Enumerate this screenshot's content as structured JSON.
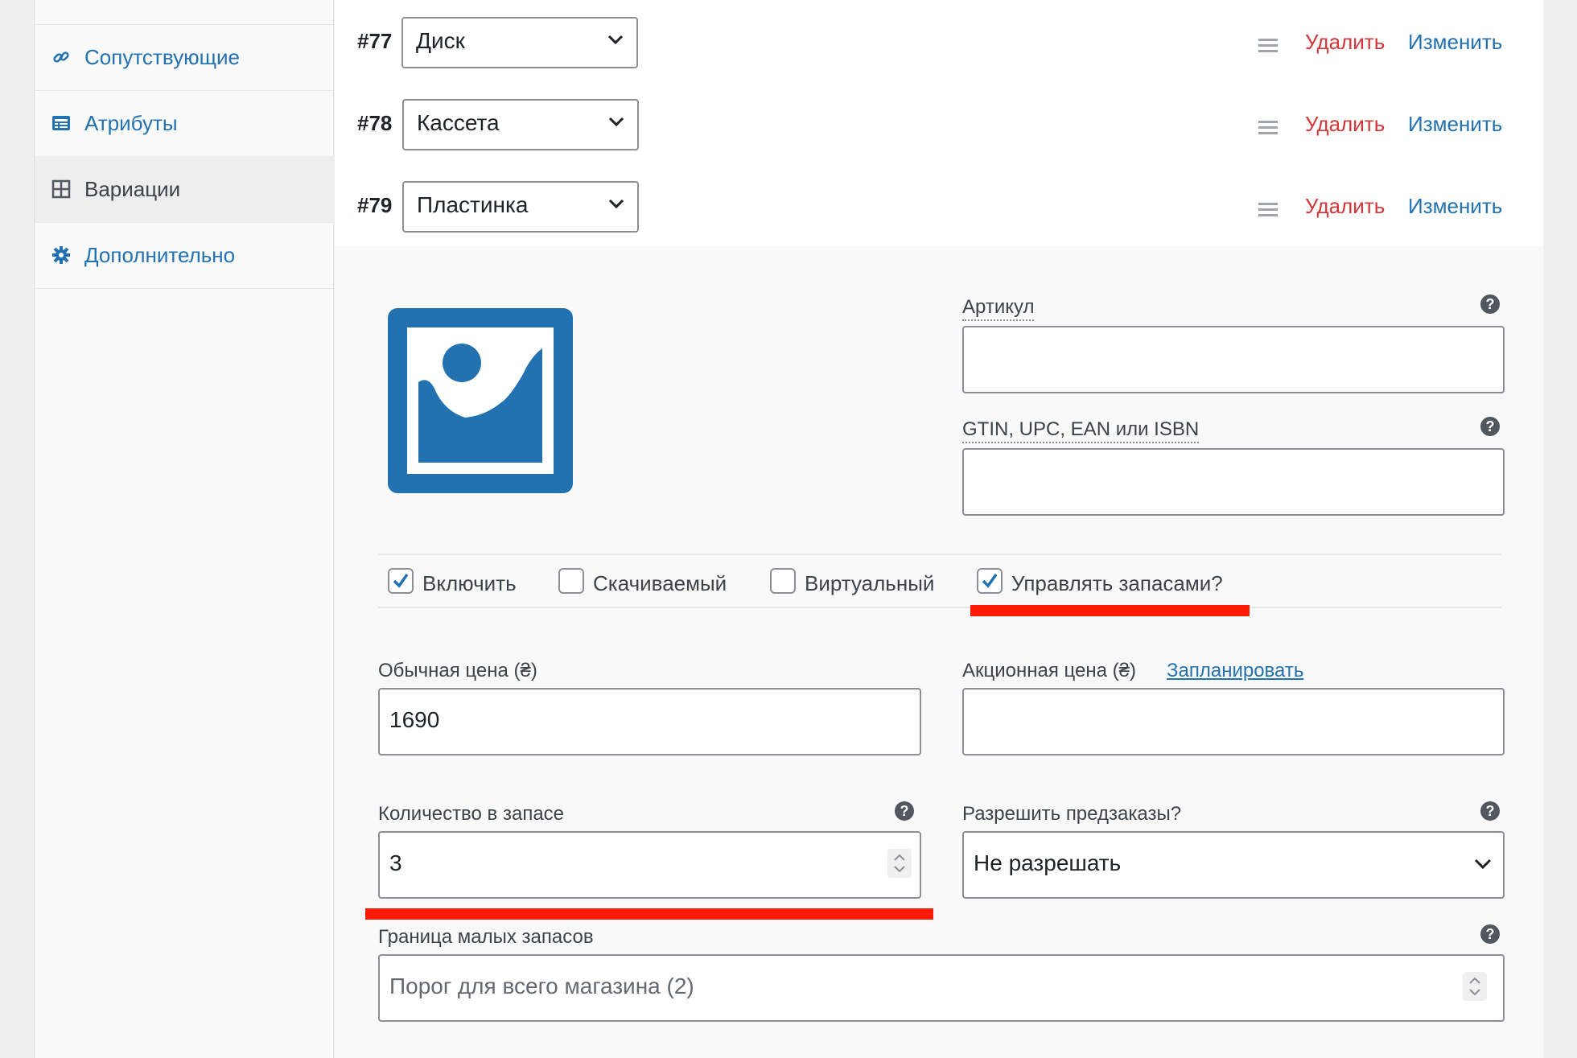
{
  "sidebar": {
    "items": [
      {
        "label": "Сопутствующие",
        "icon": "link-icon"
      },
      {
        "label": "Атрибуты",
        "icon": "attributes-icon"
      },
      {
        "label": "Вариации",
        "icon": "grid-icon",
        "active": true
      },
      {
        "label": "Дополнительно",
        "icon": "gear-icon"
      }
    ]
  },
  "variations": [
    {
      "number": "#77",
      "value": "Диск",
      "delete": "Удалить",
      "edit": "Изменить"
    },
    {
      "number": "#78",
      "value": "Кассета",
      "delete": "Удалить",
      "edit": "Изменить"
    },
    {
      "number": "#79",
      "value": "Пластинка",
      "delete": "Удалить",
      "edit": "Изменить"
    }
  ],
  "form": {
    "sku_label": "Артикул",
    "sku_value": "",
    "gtin_label": "GTIN, UPC, EAN или ISBN",
    "gtin_value": "",
    "checkboxes": [
      {
        "label": "Включить",
        "checked": true
      },
      {
        "label": "Скачиваемый",
        "checked": false
      },
      {
        "label": "Виртуальный",
        "checked": false
      },
      {
        "label": "Управлять запасами?",
        "checked": true
      }
    ],
    "regular_price_label": "Обычная цена (₴)",
    "regular_price_value": "1690",
    "sale_price_label": "Акционная цена (₴)",
    "sale_price_schedule": "Запланировать",
    "sale_price_value": "",
    "stock_qty_label": "Количество в запасе",
    "stock_qty_value": "3",
    "backorders_label": "Разрешить предзаказы?",
    "backorders_value": "Не разрешать",
    "low_stock_label": "Граница малых запасов",
    "low_stock_placeholder": "Порог для всего магазина (2)",
    "help_glyph": "?"
  },
  "colors": {
    "accent": "#2271b1",
    "danger": "#d63638",
    "highlight": "#ff1a00"
  }
}
